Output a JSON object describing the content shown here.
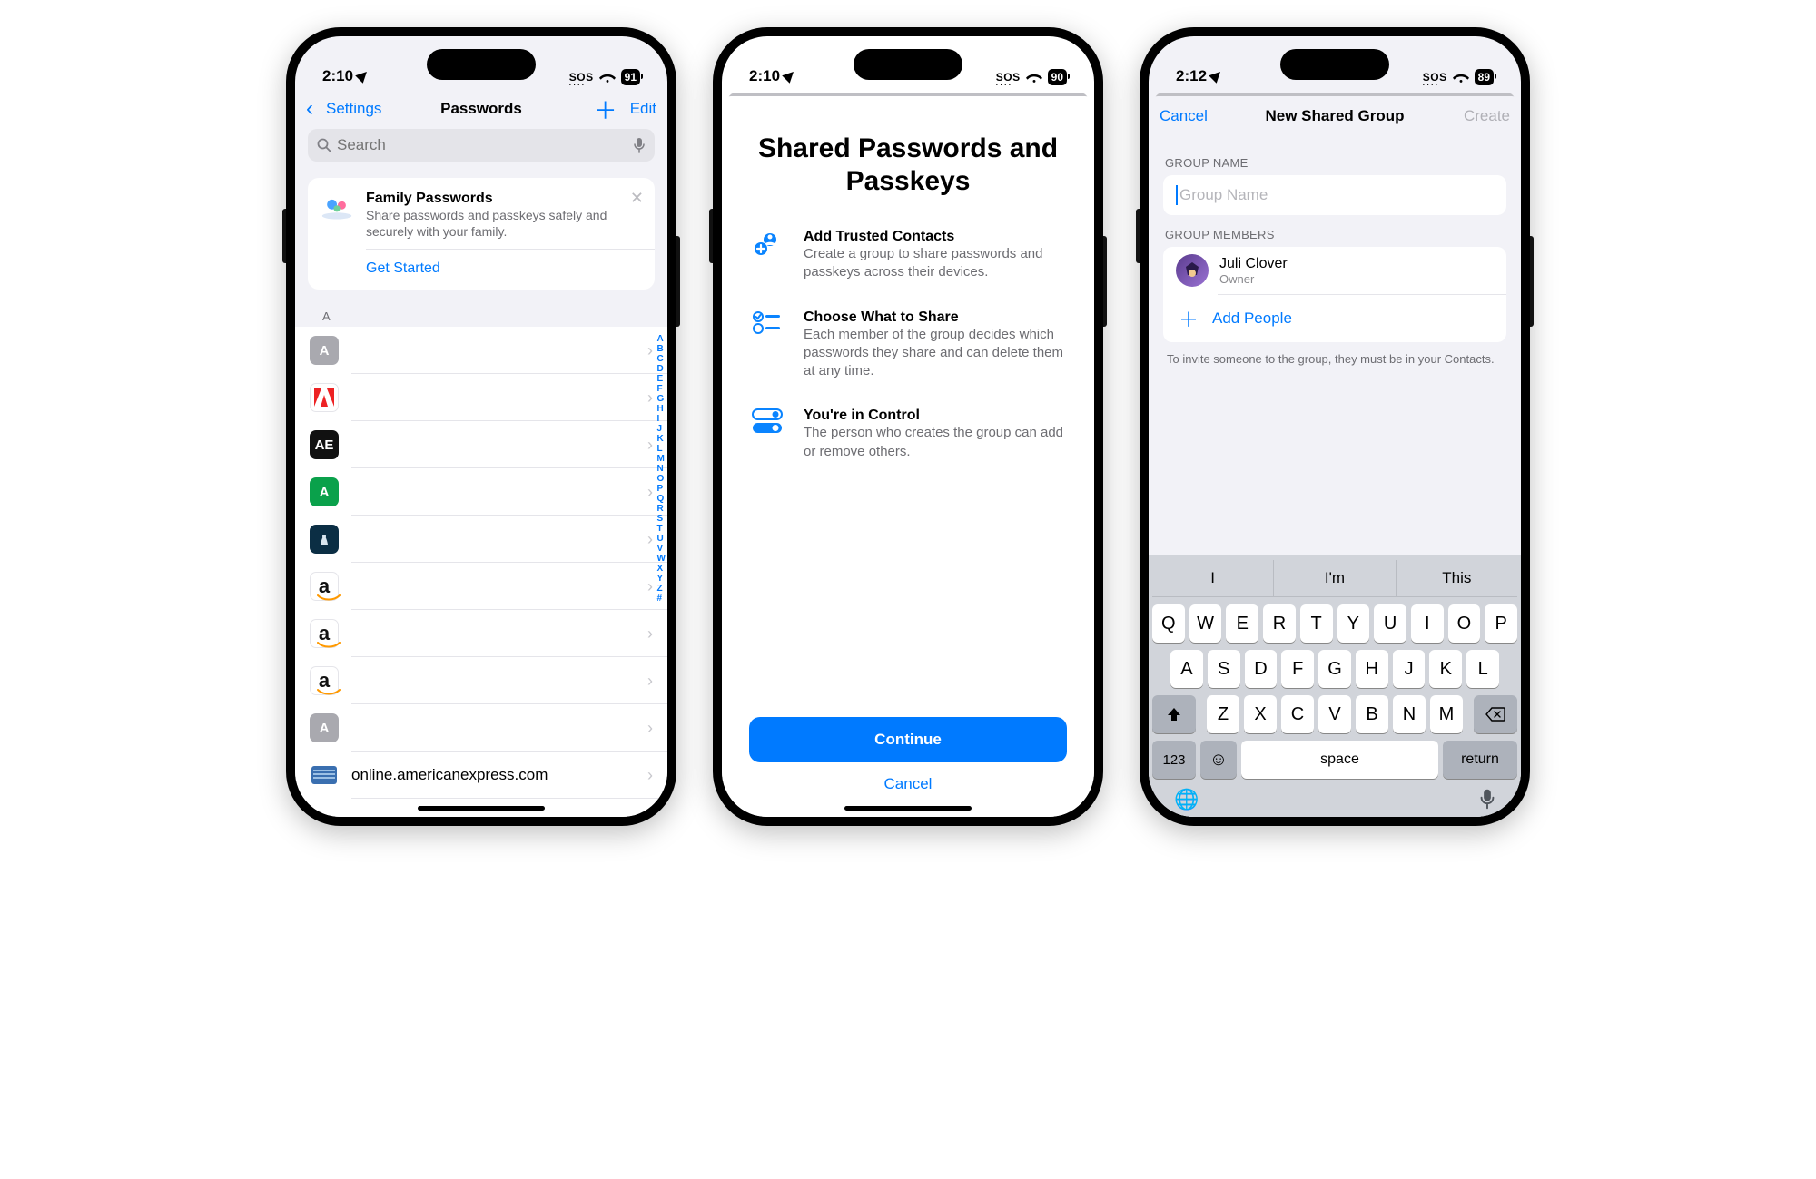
{
  "phone1": {
    "status": {
      "time": "2:10",
      "sos": "SOS",
      "battery": "91"
    },
    "nav": {
      "back": "Settings",
      "title": "Passwords",
      "edit": "Edit"
    },
    "search": {
      "placeholder": "Search"
    },
    "family": {
      "title": "Family Passwords",
      "subtitle": "Share passwords and passkeys safely and securely with your family.",
      "cta": "Get Started"
    },
    "sectionLetter": "A",
    "rows": [
      {
        "bg": "#a9a9af",
        "label": "A",
        "text": ""
      },
      {
        "bg": "#ffffff",
        "label": "",
        "text": "",
        "adobe": true
      },
      {
        "bg": "#111111",
        "label": "AE",
        "text": ""
      },
      {
        "bg": "#0aa14b",
        "label": "A",
        "text": ""
      },
      {
        "bg": "#0b2e44",
        "label": "",
        "text": "",
        "alaska": true
      },
      {
        "bg": "#ffffff",
        "label": "a",
        "text": "",
        "amazon": true
      },
      {
        "bg": "#ffffff",
        "label": "a",
        "text": "",
        "amazon": true
      },
      {
        "bg": "#ffffff",
        "label": "a",
        "text": "",
        "amazon": true
      },
      {
        "bg": "#a9a9af",
        "label": "A",
        "text": ""
      },
      {
        "bg": "#3a6fb0",
        "label": "",
        "text": "online.americanexpress.com",
        "amex": true
      }
    ],
    "index": [
      "A",
      "B",
      "C",
      "D",
      "E",
      "F",
      "G",
      "H",
      "I",
      "J",
      "K",
      "L",
      "M",
      "N",
      "O",
      "P",
      "Q",
      "R",
      "S",
      "T",
      "U",
      "V",
      "W",
      "X",
      "Y",
      "Z",
      "#"
    ]
  },
  "phone2": {
    "status": {
      "time": "2:10",
      "sos": "SOS",
      "battery": "90"
    },
    "title": "Shared Passwords and Passkeys",
    "features": [
      {
        "t": "Add Trusted Contacts",
        "s": "Create a group to share passwords and passkeys across their devices."
      },
      {
        "t": "Choose What to Share",
        "s": "Each member of the group decides which passwords they share and can delete them at any time."
      },
      {
        "t": "You're in Control",
        "s": "The person who creates the group can add or remove others."
      }
    ],
    "continue": "Continue",
    "cancel": "Cancel"
  },
  "phone3": {
    "status": {
      "time": "2:12",
      "sos": "SOS",
      "battery": "89"
    },
    "nav": {
      "cancel": "Cancel",
      "title": "New Shared Group",
      "create": "Create"
    },
    "groupNameLabel": "GROUP NAME",
    "groupNamePlaceholder": "Group Name",
    "membersLabel": "GROUP MEMBERS",
    "member": {
      "name": "Juli Clover",
      "role": "Owner"
    },
    "addPeople": "Add People",
    "hint": "To invite someone to the group, they must be in your Contacts.",
    "suggestions": [
      "I",
      "I'm",
      "This"
    ],
    "keys": {
      "r1": [
        "Q",
        "W",
        "E",
        "R",
        "T",
        "Y",
        "U",
        "I",
        "O",
        "P"
      ],
      "r2": [
        "A",
        "S",
        "D",
        "F",
        "G",
        "H",
        "J",
        "K",
        "L"
      ],
      "r3": [
        "Z",
        "X",
        "C",
        "V",
        "B",
        "N",
        "M"
      ],
      "n123": "123",
      "space": "space",
      "return": "return"
    }
  }
}
